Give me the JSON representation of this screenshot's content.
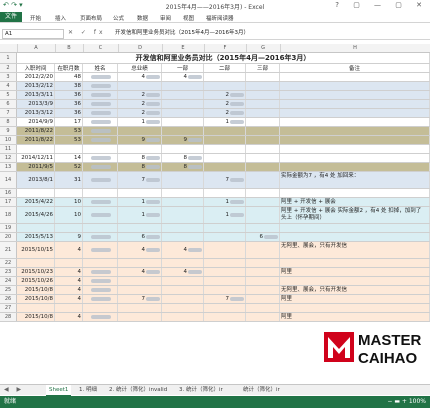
{
  "window": {
    "title": "2015年4月——2016年3月) - Excel",
    "controls": "?  ▢  —  ▢  ✕"
  },
  "quick_access": "↶ ↷ ▾",
  "ribbon": {
    "file": "文件",
    "tabs": [
      "开始",
      "插入",
      "页面布局",
      "公式",
      "数据",
      "审阅",
      "视图",
      "福昕阅读器"
    ]
  },
  "formula_bar": {
    "cell": "A1",
    "fx": "✕ ✓ fx",
    "content": "开发信和阿里业务员对比（2015年4月—2016年3月）"
  },
  "columns": [
    "A",
    "B",
    "C",
    "D",
    "E",
    "F",
    "G",
    "H"
  ],
  "sheet_title": "开发信和阿里业务员对比（2015年4月—2016年3月）",
  "headers": {
    "a": "入职时间",
    "b": "在职月数",
    "c": "姓名",
    "d": "总业绩",
    "e": "一部",
    "f": "二部",
    "g": "三部",
    "h": "备注"
  },
  "rows": [
    {
      "n": "3",
      "a": "2012/2/20",
      "b": "48",
      "d": "4",
      "e": "4",
      "f": "",
      "g": "",
      "h": ""
    },
    {
      "n": "4",
      "a": "2013/2/12",
      "b": "38",
      "d": "",
      "e": "",
      "f": "",
      "g": "",
      "h": ""
    },
    {
      "n": "5",
      "a": "2013/3/11",
      "b": "36",
      "d": "2",
      "e": "",
      "f": "2",
      "g": "",
      "h": ""
    },
    {
      "n": "6",
      "a": "2013/3/9",
      "b": "36",
      "d": "2",
      "e": "",
      "f": "2",
      "g": "",
      "h": ""
    },
    {
      "n": "7",
      "a": "2013/3/12",
      "b": "36",
      "d": "2",
      "e": "",
      "f": "2",
      "g": "",
      "h": ""
    },
    {
      "n": "8",
      "a": "2014/9/9",
      "b": "17",
      "d": "1",
      "e": "",
      "f": "1",
      "g": "",
      "h": ""
    },
    {
      "n": "9",
      "a": "2011/8/22",
      "b": "53",
      "d": "",
      "e": "",
      "f": "",
      "g": "",
      "h": ""
    },
    {
      "n": "10",
      "a": "2011/8/22",
      "b": "53",
      "d": "9",
      "e": "9",
      "f": "",
      "g": "",
      "h": ""
    },
    {
      "n": "11",
      "a": "",
      "b": "",
      "d": "",
      "e": "",
      "f": "",
      "g": "",
      "h": ""
    },
    {
      "n": "12",
      "a": "2014/12/11",
      "b": "14",
      "d": "8",
      "e": "8",
      "f": "",
      "g": "",
      "h": ""
    },
    {
      "n": "13",
      "a": "2011/9/5",
      "b": "52",
      "d": "8",
      "e": "8",
      "f": "",
      "g": "",
      "h": ""
    },
    {
      "n": "14",
      "a": "2013/8/1",
      "b": "31",
      "d": "7",
      "e": "",
      "f": "7",
      "g": "",
      "h": "实际金额为7 ，有4 处 加回来："
    },
    {
      "n": "16",
      "a": "",
      "b": "",
      "d": "",
      "e": "",
      "f": "",
      "g": "",
      "h": ""
    },
    {
      "n": "17",
      "a": "2015/4/22",
      "b": "10",
      "d": "1",
      "e": "",
      "f": "1",
      "g": "",
      "h": "阿里 + 开发信 + 展会"
    },
    {
      "n": "18",
      "a": "2015/4/26",
      "b": "10",
      "d": "1",
      "e": "",
      "f": "1",
      "g": "",
      "h": "阿里 + 开发信 + 展会  实际金额2 ，有4 处 扣掉，加到了 头上（怀孕期间）"
    },
    {
      "n": "19",
      "a": "",
      "b": "",
      "d": "",
      "e": "",
      "f": "",
      "g": "",
      "h": ""
    },
    {
      "n": "20",
      "a": "2015/5/13",
      "b": "9",
      "d": "6",
      "e": "",
      "f": "",
      "g": "6",
      "h": ""
    },
    {
      "n": "21",
      "a": "2015/10/15",
      "b": "4",
      "d": "4",
      "e": "4",
      "f": "",
      "g": "",
      "h": "无阿里、展会，只有开发信"
    },
    {
      "n": "22",
      "a": "",
      "b": "",
      "d": "",
      "e": "",
      "f": "",
      "g": "",
      "h": ""
    },
    {
      "n": "23",
      "a": "2015/10/23",
      "b": "4",
      "d": "4",
      "e": "4",
      "f": "",
      "g": "",
      "h": "阿里"
    },
    {
      "n": "24",
      "a": "2015/10/26",
      "b": "4",
      "d": "",
      "e": "",
      "f": "",
      "g": "",
      "h": ""
    },
    {
      "n": "25",
      "a": "2015/10/8",
      "b": "4",
      "d": "",
      "e": "",
      "f": "",
      "g": "",
      "h": "无阿里、展会，只有开发信"
    },
    {
      "n": "26",
      "a": "2015/10/8",
      "b": "4",
      "d": "7",
      "e": "",
      "f": "7",
      "g": "",
      "h": "阿里"
    },
    {
      "n": "27",
      "a": "",
      "b": "",
      "d": "",
      "e": "",
      "f": "",
      "g": "",
      "h": ""
    },
    {
      "n": "28",
      "a": "2015/10/8",
      "b": "4",
      "d": "",
      "e": "",
      "f": "",
      "g": "",
      "h": "阿里"
    }
  ],
  "sheet_tabs": {
    "nav": "◀ ▶",
    "tabs": [
      "Sheet1",
      "1. 明细",
      "2. 统计（筛化）invalid",
      "3. 统计（筛化）ir",
      "统计（筛化）ir"
    ]
  },
  "status": {
    "ready": "就绪",
    "zoom": "− ▬ + 100%"
  },
  "logo": {
    "line1": "MASTER",
    "line2": "CAIHAO"
  }
}
